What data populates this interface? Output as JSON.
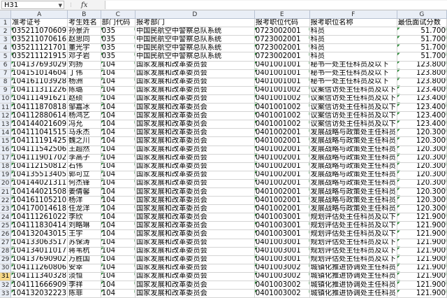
{
  "formula_bar": {
    "cell_ref": "H31",
    "fx": "fx",
    "content": ""
  },
  "columns": [
    "A",
    "B",
    "C",
    "D",
    "E",
    "F",
    "G"
  ],
  "rows": [
    [
      "准考证号",
      "考生姓名",
      "部门代码",
      "报考部门",
      "报考职位代码",
      "报考职位名称",
      "最低面试分数"
    ],
    [
      "035211070609",
      "孙景沂",
      "035",
      "中国民航空中警察总队系统",
      "0723002001",
      "科员",
      "51.700"
    ],
    [
      "035211070616",
      "赵思同",
      "035",
      "中国民航空中警察总队系统",
      "0723002001",
      "科员",
      "51.700"
    ],
    [
      "035211121701",
      "董光宇",
      "035",
      "中国民航空中警察总队系统",
      "0723002001",
      "科员",
      "51.700"
    ],
    [
      "035211121915",
      "邓子岩",
      "035",
      "中国民航空中警察总队系统",
      "0723002001",
      "科员",
      "51.700"
    ],
    [
      "104137693029",
      "刘扬",
      "104",
      "国家发展和改革委员会",
      "0401001001",
      "秘书一处主任科员及以下",
      "123.800"
    ],
    [
      "104151014604",
      "丁伟",
      "104",
      "国家发展和改革委员会",
      "0401001001",
      "秘书一处主任科员及以下",
      "123.800"
    ],
    [
      "104161103928",
      "杨洲",
      "104",
      "国家发展和改革委员会",
      "0401001001",
      "秘书一处主任科员及以下",
      "123.800"
    ],
    [
      "104111311226",
      "陈璐",
      "104",
      "国家发展和改革委员会",
      "0401001002",
      "议案信访处主任科员及以下",
      "123.400"
    ],
    [
      "104111491621",
      "赵硕",
      "104",
      "国家发展和改革委员会",
      "0401001002",
      "议案信访处主任科员及以下",
      "123.400"
    ],
    [
      "104111870818",
      "邹嘉冰",
      "104",
      "国家发展和改革委员会",
      "0401001002",
      "议案信访处主任科员及以下",
      "123.400"
    ],
    [
      "104112880614",
      "杨鸿艺",
      "104",
      "国家发展和改革委员会",
      "0401001002",
      "议案信访处主任科员及以下",
      "123.400"
    ],
    [
      "104144021609",
      "冯允",
      "104",
      "国家发展和改革委员会",
      "0401001002",
      "议案信访处主任科员及以下",
      "123.400"
    ],
    [
      "104111041515",
      "马永杰",
      "104",
      "国家发展和改革委员会",
      "0401002001",
      "发展战略与政策处主任科员",
      "120.300"
    ],
    [
      "104111191425",
      "魏之川",
      "104",
      "国家发展和改革委员会",
      "0401002001",
      "发展战略与政策处主任科员",
      "120.300"
    ],
    [
      "104111542506",
      "王超然",
      "104",
      "国家发展和改革委员会",
      "0401002001",
      "发展战略与政策处主任科员",
      "120.300"
    ],
    [
      "104111901702",
      "李高子",
      "104",
      "国家发展和改革委员会",
      "0401002001",
      "发展战略与政策处主任科员",
      "120.300"
    ],
    [
      "104112150812",
      "石伟",
      "104",
      "国家发展和改革委员会",
      "0401002001",
      "发展战略与政策处主任科员",
      "120.300"
    ],
    [
      "104135513405",
      "郭可立",
      "104",
      "国家发展和改革委员会",
      "0401002001",
      "发展战略与政策处主任科员",
      "120.300"
    ],
    [
      "104144021311",
      "何杰锋",
      "104",
      "国家发展和改革委员会",
      "0401002001",
      "发展战略与政策处主任科员",
      "120.300"
    ],
    [
      "104144021508",
      "姜倩馨",
      "104",
      "国家发展和改革委员会",
      "0401002001",
      "发展战略与政策处主任科员",
      "120.300"
    ],
    [
      "104161105210",
      "杨洋",
      "104",
      "国家发展和改革委员会",
      "0401002001",
      "发展战略与政策处主任科员",
      "120.300"
    ],
    [
      "104170014618",
      "任龙洋",
      "104",
      "国家发展和改革委员会",
      "0401002001",
      "发展战略与政策处主任科员",
      "120.300"
    ],
    [
      "104111261022",
      "李欣",
      "104",
      "国家发展和改革委员会",
      "0401003001",
      "规划评估处主任科员及以下",
      "121.900"
    ],
    [
      "104111830414",
      "刘略琳",
      "104",
      "国家发展和改革委员会",
      "0401003001",
      "规划评估处主任科员及以下",
      "121.900"
    ],
    [
      "104132043015",
      "王宇",
      "104",
      "国家发展和改革委员会",
      "0401003001",
      "规划评估处主任科员及以下",
      "121.900"
    ],
    [
      "104133063517",
      "苏保涛",
      "104",
      "国家发展和改革委员会",
      "0401003001",
      "规划评估处主任科员及以下",
      "121.900"
    ],
    [
      "104134011017",
      "蒋苇杭",
      "104",
      "国家发展和改革委员会",
      "0401003001",
      "规划评估处主任科员及以下",
      "121.900"
    ],
    [
      "104137690902",
      "万胜国",
      "104",
      "国家发展和改革委员会",
      "0401003001",
      "规划评估处主任科员及以下",
      "121.900"
    ],
    [
      "104111260806",
      "安幸",
      "104",
      "国家发展和改革委员会",
      "0401003002",
      "城镇化推进协调处主任科员",
      "121.900"
    ],
    [
      "104111340328",
      "淡恒",
      "104",
      "国家发展和改革委员会",
      "0401003002",
      "城镇化推进协调处主任科员",
      "121.900"
    ],
    [
      "104111666909",
      "李祥",
      "104",
      "国家发展和改革委员会",
      "0401003002",
      "城镇化推进协调处主任科员",
      "121.900"
    ],
    [
      "104132032223",
      "陈菲",
      "104",
      "国家发展和改革委员会",
      "0401003002",
      "城镇化推进协调处主任科员",
      "121.900"
    ]
  ]
}
